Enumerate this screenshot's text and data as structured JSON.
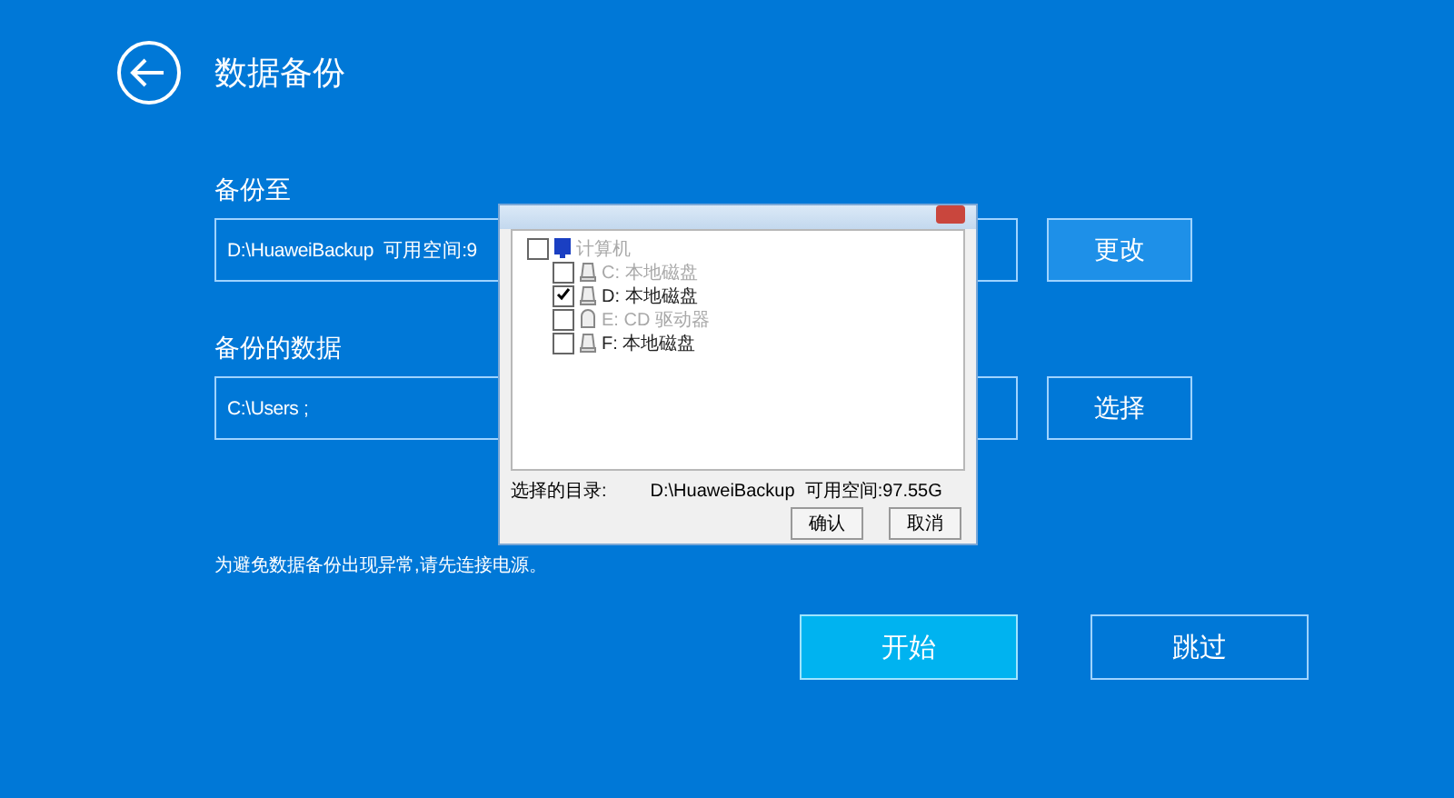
{
  "header": {
    "title": "数据备份"
  },
  "backup_to": {
    "label": "备份至",
    "value": "D:\\HuaweiBackup  可用空间:9",
    "button": "更改"
  },
  "backup_data": {
    "label": "备份的数据",
    "value": "C:\\Users ;",
    "button": "选择"
  },
  "notice": "为避免数据备份出现异常,请先连接电源。",
  "actions": [
    {
      "label": "开始",
      "primary": true
    },
    {
      "label": "跳过",
      "primary": false
    }
  ],
  "dialog": {
    "tree": {
      "label": "计算机",
      "checked": false,
      "disabled": true,
      "children": [
        {
          "label": "C: 本地磁盘",
          "kind": "disk",
          "checked": false,
          "disabled": true
        },
        {
          "label": "D: 本地磁盘",
          "kind": "disk",
          "checked": true,
          "disabled": false
        },
        {
          "label": "E: CD 驱动器",
          "kind": "cd",
          "checked": false,
          "disabled": true
        },
        {
          "label": "F: 本地磁盘",
          "kind": "disk",
          "checked": false,
          "disabled": false
        }
      ]
    },
    "selected_label": "选择的目录:",
    "selected_value": "D:\\HuaweiBackup  可用空间:97.55G",
    "buttons": [
      "确认",
      "取消"
    ]
  }
}
